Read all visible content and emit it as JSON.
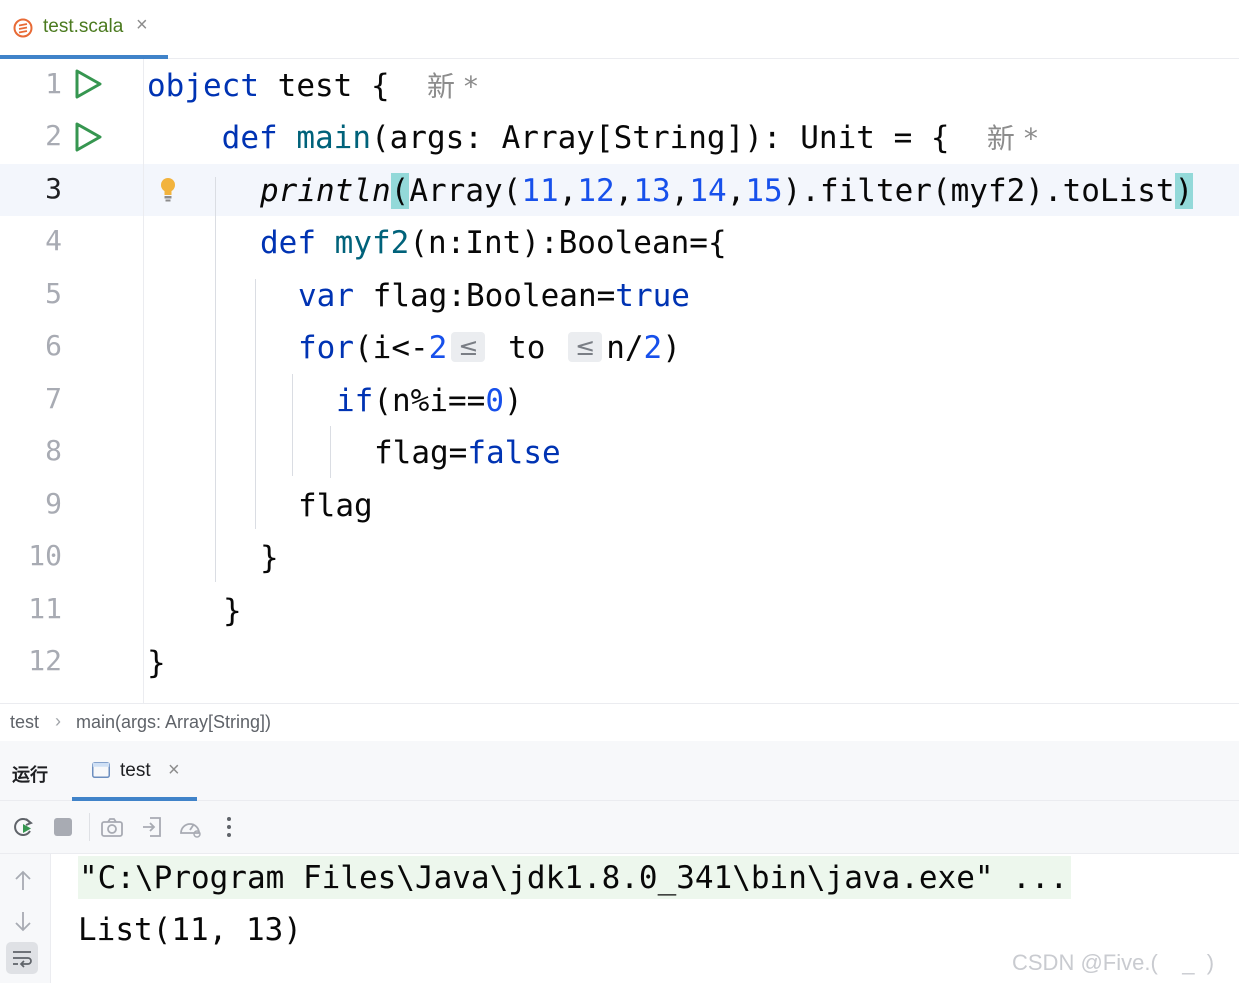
{
  "editor_tab": {
    "filename": "test.scala",
    "close": "×",
    "icon": "scala-icon"
  },
  "editor": {
    "line_numbers": [
      "1",
      "2",
      "3",
      "4",
      "5",
      "6",
      "7",
      "8",
      "9",
      "10",
      "11",
      "12"
    ],
    "active_line": "3",
    "hints": {
      "new_marker": "新",
      "modified": "*"
    },
    "tokens": {
      "object": "object",
      "test": "test",
      "brace_open": "{",
      "brace_close": "}",
      "def": "def",
      "main": "main",
      "main_args": "(args: Array[String]): Unit = {",
      "println": "println",
      "paren_open": "(",
      "paren_close": ")",
      "array_open": "Array(",
      "n11": "11",
      "n12": "12",
      "n13": "13",
      "n14": "14",
      "n15": "15",
      "comma": ",",
      "filter_chain": ").filter(myf2).toList",
      "myf2": "myf2",
      "myf2_sig": "(n:Int):Boolean={",
      "var": "var",
      "flag_decl": " flag:Boolean=",
      "true": "true",
      "for": "for",
      "for_open": "(i<-",
      "n2": "2",
      "leq": "≤",
      "to": "to",
      "n_div": "n/",
      "for_close": ")",
      "if": "if",
      "if_cond": "(n%i==",
      "n0": "0",
      "flag_assign": "flag=",
      "false": "false",
      "flag": "flag"
    }
  },
  "breadcrumb": {
    "item1": "test",
    "separator": "›",
    "item2": "main(args: Array[String])"
  },
  "run_panel": {
    "title": "运行",
    "tab_label": "test",
    "tab_close": "×",
    "toolbar_icons": [
      "rerun-icon",
      "stop-icon",
      "camera-icon",
      "exit-icon",
      "profiler-icon",
      "more-icon"
    ],
    "side_icons": [
      "arrow-up-icon",
      "arrow-down-icon",
      "soft-wrap-icon"
    ]
  },
  "console": {
    "command_line": "\"C:\\Program Files\\Java\\jdk1.8.0_341\\bin\\java.exe\" ...",
    "output_line": "List(11, 13)"
  },
  "watermark": "CSDN @Five.(    _  )",
  "colors": {
    "keyword": "#0033b3",
    "number": "#1750eb",
    "function": "#00627a",
    "accent": "#4083c9",
    "run_green": "#369650"
  }
}
